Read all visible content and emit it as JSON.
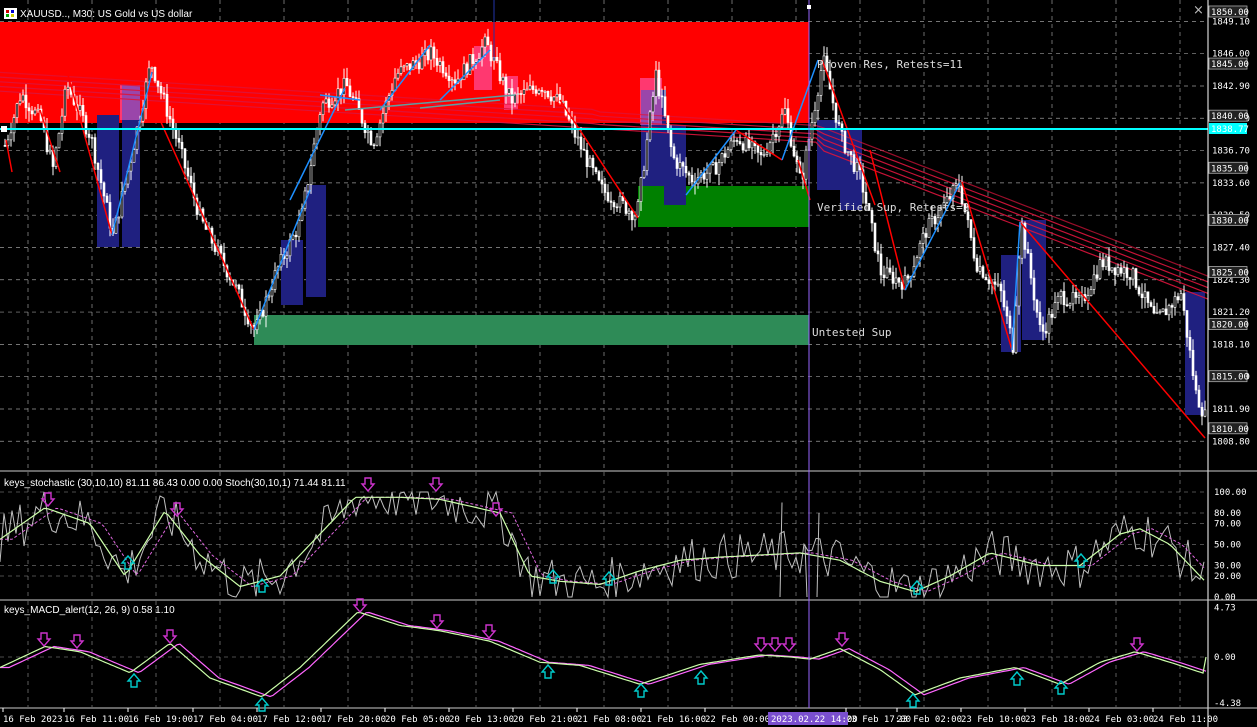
{
  "header": {
    "title": "XAUUSD.., M30:  US Gold vs US dollar"
  },
  "window": {
    "close_glyph": "×"
  },
  "colors": {
    "background": "#000000",
    "grid": "#9a9a9a",
    "resistance_zone": "#ff0000",
    "verified_support_zone": "#008000",
    "untested_support_zone": "#2e8b57",
    "current_price_line": "#00ffff",
    "bull_candle": "#ffffff",
    "bear_candle": "#ffffff",
    "zigzag_down": "#ff0000",
    "zigzag_up": "#1e90ff",
    "bar_highlight_navy": "#1f2080",
    "bar_highlight_magenta": "#ff66cc",
    "ma_ribbon": "#dc143c",
    "signal_down": "#cc33cc",
    "signal_up": "#00cccc",
    "separator_line": "#9966ff"
  },
  "zones": {
    "resistance_label": "Proven Res, Retests=11",
    "verified_label": "Verified Sup, Retests=2",
    "untested_label": "Untested Sup"
  },
  "price_axis": {
    "ticks": [
      "1849.10",
      "1846.00",
      "1842.90",
      "1839.80",
      "1836.70",
      "1833.60",
      "1830.50",
      "1827.40",
      "1824.30",
      "1821.20",
      "1818.10",
      "1815.00",
      "1811.90",
      "1808.80"
    ],
    "boxed": [
      {
        "text": "1850.00",
        "kind": "level"
      },
      {
        "text": "1845.00",
        "kind": "level"
      },
      {
        "text": "1840.00",
        "kind": "level"
      },
      {
        "text": "1838.77",
        "kind": "current"
      },
      {
        "text": "1835.00",
        "kind": "level"
      },
      {
        "text": "1830.00",
        "kind": "level"
      },
      {
        "text": "1825.00",
        "kind": "level"
      },
      {
        "text": "1820.00",
        "kind": "level"
      },
      {
        "text": "1815.00",
        "kind": "level"
      },
      {
        "text": "1810.00",
        "kind": "level"
      }
    ]
  },
  "stochastic": {
    "title": "keys_stochastic (30,10,10) 81.11 86.43 0.00 0.00 Stoch(30,10,1) 71.44 81.11",
    "ticks": [
      "100.00",
      "80.00",
      "70.00",
      "50.00",
      "30.00",
      "20.00",
      "0.00"
    ]
  },
  "macd": {
    "title": "keys_MACD_alert(12, 26, 9) 0.58 1.10",
    "ticks": [
      "4.73",
      "0.00",
      "-4.38"
    ]
  },
  "time_axis": {
    "labels": [
      "16 Feb 2023",
      "16 Feb 11:00",
      "16 Feb 19:00",
      "17 Feb 04:00",
      "17 Feb 12:00",
      "17 Feb 20:00",
      "20 Feb 05:00",
      "20 Feb 13:00",
      "20 Feb 21:00",
      "21 Feb 08:00",
      "21 Feb 16:00",
      "22 Feb 00:00",
      "23 Feb 17:00",
      "23 Feb 02:00",
      "23 Feb 10:00",
      "23 Feb 18:00",
      "24 Feb 03:00",
      "24 Feb 11:00"
    ],
    "cursor_label": "2023.02.22 14:00"
  }
}
